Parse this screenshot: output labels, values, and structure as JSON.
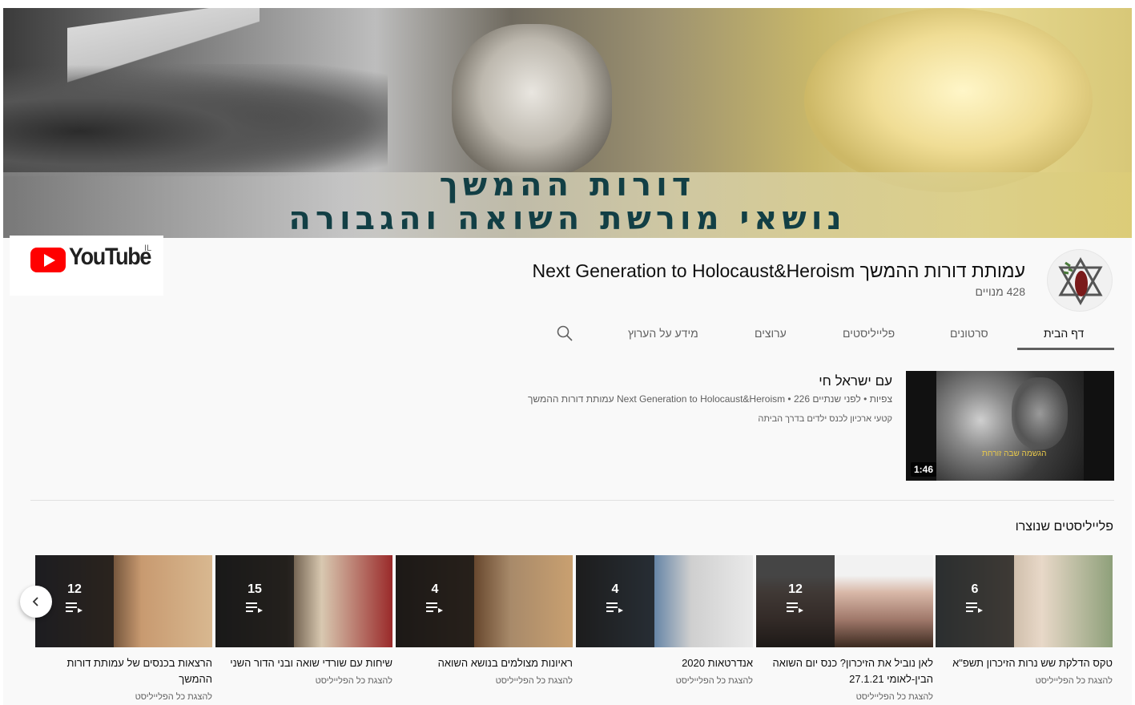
{
  "banner": {
    "line1": "דורות ההמשך",
    "line2": "נושאי מורשת השואה והגבורה"
  },
  "logo": {
    "word": "YouTube",
    "country": "IL"
  },
  "channel": {
    "title": "Next Generation to Holocaust&Heroism עמותת דורות ההמשך",
    "subscribers": "428 מנויים"
  },
  "tabs": [
    {
      "label": "דף הבית",
      "active": true
    },
    {
      "label": "סרטונים",
      "active": false
    },
    {
      "label": "פלייליסטים",
      "active": false
    },
    {
      "label": "ערוצים",
      "active": false
    },
    {
      "label": "מידע על הערוץ",
      "active": false
    }
  ],
  "icons": {
    "search": "search-icon",
    "prev": "chevron-left-icon",
    "queue": "playlist-queue-icon"
  },
  "featured": {
    "title": "עם ישראל חי",
    "meta": "עמותת דורות ההמשך Next Generation to Holocaust&Heroism • 226 צפיות • לפני שנתיים",
    "description": "קטעי ארכיון לכנס ילדים בדרך הביתה",
    "thumb_caption": "הגשמה שבה זורחת",
    "duration": "1:46"
  },
  "playlists_section": {
    "title": "פלייליסטים שנוצרו",
    "link_label": "להצגת כל הפלייליסט",
    "items": [
      {
        "count": "6",
        "title": "טקס הדלקת שש נרות הזיכרון תשפ\"א"
      },
      {
        "count": "12",
        "title": "לאן נוביל את הזיכרון? כנס יום השואה הבין-לאומי 27.1.21"
      },
      {
        "count": "4",
        "title": "אנדרטאות 2020"
      },
      {
        "count": "4",
        "title": "ראיונות מצולמים בנושא השואה"
      },
      {
        "count": "15",
        "title": "שיחות עם שורדי שואה ובני הדור השני"
      },
      {
        "count": "12",
        "title": "הרצאות בכנסים של עמותת דורות ההמשך"
      }
    ]
  },
  "colors": {
    "brand_red": "#ff0000",
    "banner_text": "#123f45",
    "muted": "#606060"
  }
}
